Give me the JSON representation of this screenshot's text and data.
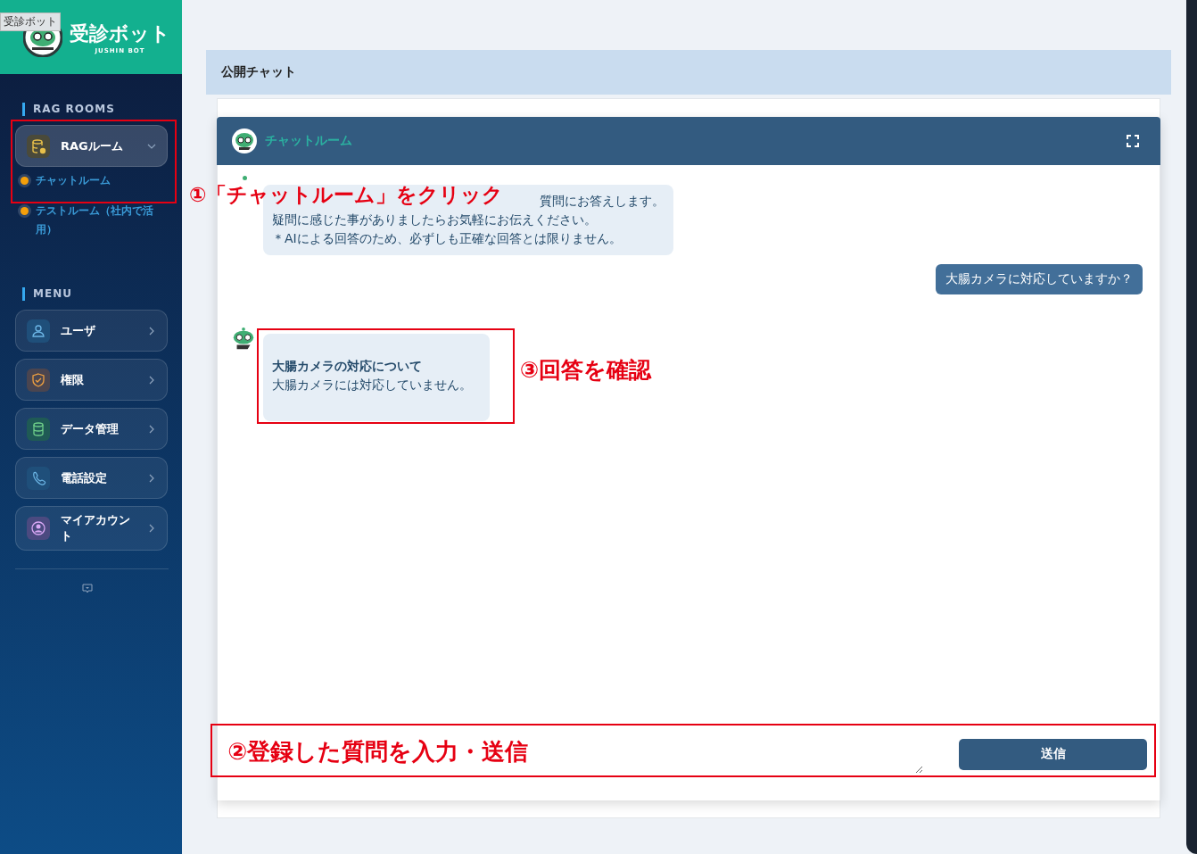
{
  "tooltip": "受診ボット",
  "brand": {
    "name": "受診ボット",
    "subtitle": "JUSHIN BOT"
  },
  "sidebar": {
    "rag_section": "RAG ROOMS",
    "rag_group": {
      "label": "RAGルーム",
      "expanded": true,
      "rooms": [
        {
          "label": "チャットルーム"
        },
        {
          "label": "テストルーム（社内で活用）"
        }
      ]
    },
    "menu_section": "MENU",
    "menu": [
      {
        "label": "ユーザ",
        "kind": "user"
      },
      {
        "label": "権限",
        "kind": "shield"
      },
      {
        "label": "データ管理",
        "kind": "database"
      },
      {
        "label": "電話設定",
        "kind": "phone"
      },
      {
        "label": "マイアカウント",
        "kind": "account"
      }
    ]
  },
  "page_title": "公開チャット",
  "chat": {
    "title": "チャットルーム",
    "messages": [
      {
        "kind": "bot",
        "lines": [
          "質問にお答えします。",
          "疑問に感じた事がありましたらお気軽にお伝えください。",
          "＊AIによる回答のため、必ずしも正確な回答とは限りません。"
        ]
      },
      {
        "kind": "user",
        "lines": [
          "大腸カメラに対応していますか？"
        ]
      },
      {
        "kind": "bot",
        "heading": "大腸カメラの対応について",
        "lines": [
          "大腸カメラには対応していません。"
        ]
      }
    ],
    "send_button": "送信"
  },
  "annotations": [
    {
      "text": "①「チャットルーム」をクリック"
    },
    {
      "text": "②登録した質問を入力・送信"
    },
    {
      "text": "③回答を確認"
    }
  ]
}
